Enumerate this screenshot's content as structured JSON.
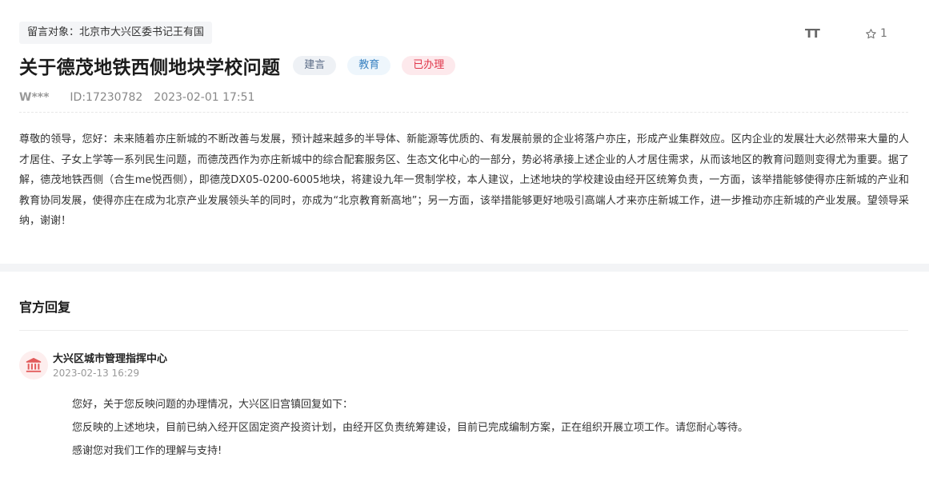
{
  "message": {
    "recipient": "留言对象：北京市大兴区委书记王有国",
    "title": "关于德茂地铁西侧地块学校问题",
    "tags": [
      "建言",
      "教育",
      "已办理"
    ],
    "author": "W***",
    "id_label": "ID:17230782",
    "datetime": "2023-02-01 17:51",
    "body": "尊敬的领导，您好：未来随着亦庄新城的不断改善与发展，预计越来越多的半导体、新能源等优质的、有发展前景的企业将落户亦庄，形成产业集群效应。区内企业的发展壮大必然带来大量的人才居住、子女上学等一系列民生问题，而德茂西作为亦庄新城中的综合配套服务区、生态文化中心的一部分，势必将承接上述企业的人才居住需求，从而该地区的教育问题则变得尤为重要。据了解，德茂地铁西侧（合生me悦西侧），即德茂DX05-0200-6005地块，将建设九年一贯制学校，本人建议，上述地块的学校建设由经开区统筹负责，一方面，该举措能够使得亦庄新城的产业和教育协同发展，使得亦庄在成为北京产业发展领头羊的同时，亦成为“北京教育新高地”；另一方面，该举措能够更好地吸引高端人才来亦庄新城工作，进一步推动亦庄新城的产业发展。望领导采纳，谢谢！"
  },
  "toolbar": {
    "font_size_icon": "text-size-icon",
    "font_size_glyph": "TT",
    "star_icon": "star-outline-icon",
    "star_count": "1"
  },
  "reply": {
    "heading": "官方回复",
    "org_icon": "government-building-icon",
    "org_name": "大兴区城市管理指挥中心",
    "datetime": "2023-02-13 16:29",
    "lines": [
      "您好，关于您反映问题的办理情况，大兴区旧宫镇回复如下：",
      "您反映的上述地块，目前已纳入经开区固定资产投资计划，由经开区负责统筹建设，目前已完成编制方案，正在组织开展立项工作。请您耐心等待。",
      "感谢您对我们工作的理解与支持!"
    ]
  },
  "colors": {
    "tag_suggest_bg": "#eef1f5",
    "tag_suggest_text": "#5a6b86",
    "tag_edu_bg": "#eef6fc",
    "tag_edu_text": "#3b83c2",
    "tag_done_bg": "#fde9ec",
    "tag_done_text": "#e0364a",
    "org_icon_color": "#e25b5b"
  }
}
